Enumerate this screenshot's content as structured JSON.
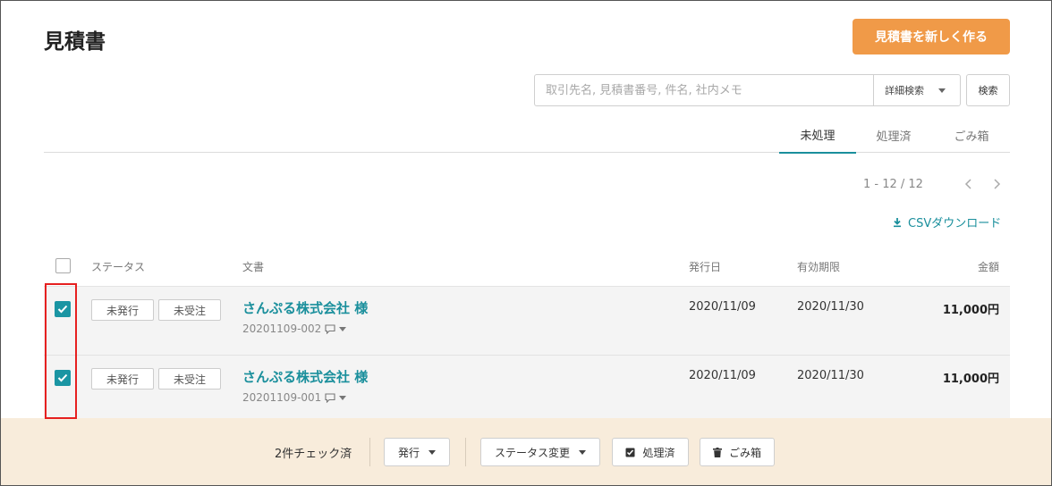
{
  "page": {
    "title": "見積書",
    "new_button_label": "見積書を新しく作る"
  },
  "search": {
    "placeholder": "取引先名, 見積書番号, 件名, 社内メモ",
    "value": "",
    "detail_label": "詳細検索",
    "button_label": "検索"
  },
  "tabs": [
    {
      "label": "未処理",
      "active": true
    },
    {
      "label": "処理済",
      "active": false
    },
    {
      "label": "ごみ箱",
      "active": false
    }
  ],
  "pager": {
    "text": "1 - 12 / 12"
  },
  "csv_label": "CSVダウンロード",
  "table": {
    "headers": {
      "status": "ステータス",
      "document": "文書",
      "issue_date": "発行日",
      "expiry": "有効期限",
      "amount": "金額"
    },
    "rows": [
      {
        "checked": true,
        "badge1": "未発行",
        "badge2": "未受注",
        "company": "さんぷる株式会社 様",
        "doc_no": "20201109-002",
        "issue_date": "2020/11/09",
        "expiry": "2020/11/30",
        "amount": "11,000円"
      },
      {
        "checked": true,
        "badge1": "未発行",
        "badge2": "未受注",
        "company": "さんぷる株式会社 様",
        "doc_no": "20201109-001",
        "issue_date": "2020/11/09",
        "expiry": "2020/11/30",
        "amount": "11,000円"
      }
    ]
  },
  "bottom_bar": {
    "checked_count_text": "2件チェック済",
    "issue_label": "発行",
    "status_change_label": "ステータス変更",
    "processed_label": "処理済",
    "trash_label": "ごみ箱"
  },
  "colors": {
    "accent": "#1a8f9c",
    "primary_button": "#f09a48",
    "highlight": "#e62020",
    "bottom_bar_bg": "#f8ecdb"
  }
}
